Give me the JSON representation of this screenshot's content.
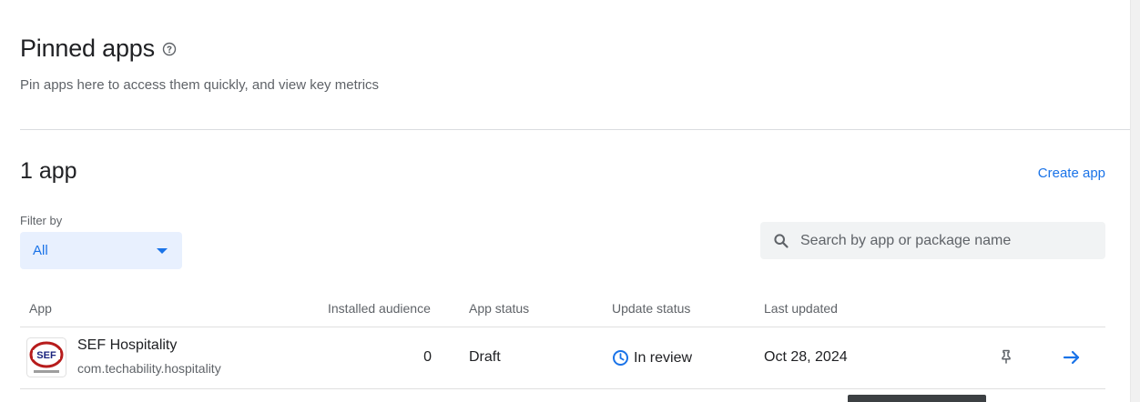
{
  "pinned": {
    "title": "Pinned apps",
    "subtitle": "Pin apps here to access them quickly, and view key metrics"
  },
  "apps": {
    "count_title": "1 app",
    "create_label": "Create app",
    "filter": {
      "label": "Filter by",
      "value": "All"
    },
    "search": {
      "placeholder": "Search by app or package name",
      "value": ""
    },
    "columns": [
      "App",
      "Installed audience",
      "App status",
      "Update status",
      "Last updated"
    ],
    "rows": [
      {
        "name": "SEF Hospitality",
        "package": "com.techability.hospitality",
        "installed_audience": "0",
        "app_status": "Draft",
        "update_status": "In review",
        "last_updated": "Oct 28, 2024",
        "logo_text": "SEF"
      }
    ]
  },
  "colors": {
    "accent": "#1a73e8",
    "filter_bg": "#e8f0fe",
    "search_bg": "#f1f3f4",
    "text_secondary": "#5f6368"
  },
  "icons": [
    "help-icon",
    "caret-down-icon",
    "search-icon",
    "clock-icon",
    "pin-icon",
    "arrow-right-icon"
  ]
}
